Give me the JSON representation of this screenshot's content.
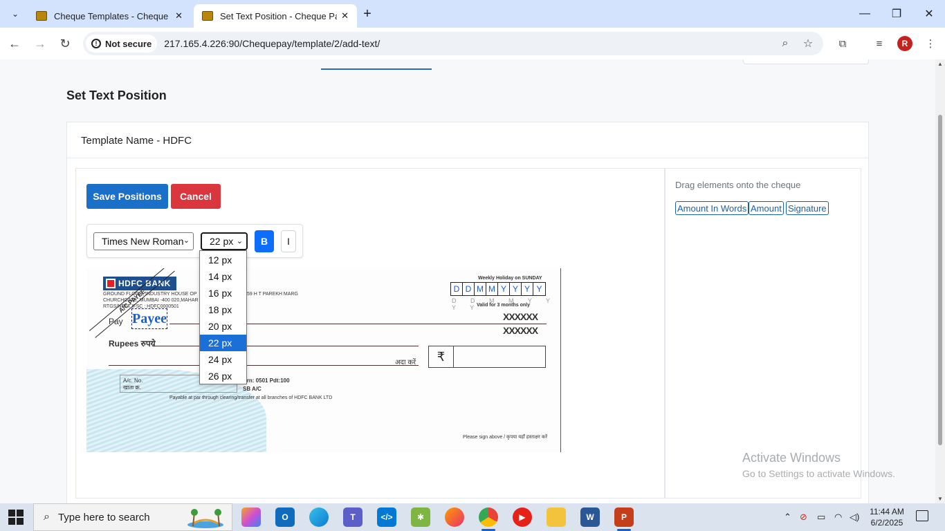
{
  "browser": {
    "tabs": [
      {
        "title": "Cheque Templates - Cheque Pa",
        "active": false
      },
      {
        "title": "Set Text Position - Cheque Pay",
        "active": true
      }
    ],
    "security_label": "Not secure",
    "url": "217.165.4.226:90/Chequepay/template/2/add-text/",
    "profile_initial": "R"
  },
  "page": {
    "title": "Set Text Position",
    "template_name": "Template Name - HDFC",
    "save_label": "Save Positions",
    "cancel_label": "Cancel"
  },
  "style_bar": {
    "font_value": "Times New Roman",
    "size_value": "22 px",
    "bold_label": "B",
    "italic_label": "I",
    "size_options": [
      "12 px",
      "14 px",
      "16 px",
      "18 px",
      "20 px",
      "22 px",
      "24 px",
      "26 px"
    ],
    "selected_size_index": 5
  },
  "cheque": {
    "bank_name": "HDFC BANK",
    "branch_line1": "GROUND FLOOR, INDUSTRY HOUSE OP",
    "branch_line1b": "59 H T PAREKH MARG",
    "branch_line2": "CHURCHGATE, MUMBAI -400 020,MAHAR",
    "branch_line3": "RTGS/NEFT IFSC : HDFC0000501",
    "crossing": "A/C PAYEE",
    "payee_text": "Payee",
    "pay_label": "Pay",
    "rupees_label": "Rupees रुपये",
    "weekly_holiday": "Weekly Holiday on SUNDAY",
    "date_chars": [
      "D",
      "D",
      "M",
      "M",
      "Y",
      "Y",
      "Y",
      "Y"
    ],
    "date_under": "D D M M Y Y Y Y",
    "validity": "Valid for 3 months only",
    "or_bearer": "XXXXXX",
    "or_bearer2": "XXXXXX",
    "ada_kare": "अदा करें",
    "rupee_symbol": "₹",
    "ac_no_label": "A/c. No.",
    "ac_no_hindi": "खाता क्र.",
    "branch_code": "Brn: 0501  Pdt:100",
    "sb_ac": "SB A/C",
    "payable_at_par": "Payable at par through clearing/transfer at all branches of HDFC BANK LTD",
    "sign_note": "Please sign above / कृपया यहाँ हस्ताक्षर करें"
  },
  "right_panel": {
    "hint": "Drag elements onto the cheque",
    "chips": [
      "Amount In Words",
      "Amount",
      "Signature"
    ]
  },
  "watermark": {
    "line1": "Activate Windows",
    "line2": "Go to Settings to activate Windows."
  },
  "taskbar": {
    "search_placeholder": "Type here to search",
    "time": "11:44 AM",
    "date": "6/2/2025"
  },
  "colors": {
    "primary": "#1a6fc9",
    "danger": "#d9363e",
    "bold_active": "#0d6efd",
    "payee_blue": "#1a5fcf"
  }
}
